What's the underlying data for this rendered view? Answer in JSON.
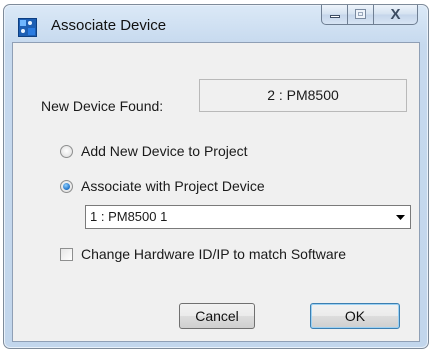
{
  "window": {
    "title": "Associate Device",
    "close_glyph": "X"
  },
  "device_found": {
    "label": "New Device Found:",
    "value": "2 : PM8500"
  },
  "options": {
    "add_new": {
      "label": "Add New Device to Project",
      "selected": false
    },
    "associate": {
      "label": "Associate with Project Device",
      "selected": true
    }
  },
  "project_device": {
    "selected": "1 : PM8500 1"
  },
  "change_hw": {
    "label": "Change Hardware ID/IP to match Software",
    "checked": false
  },
  "buttons": {
    "cancel": "Cancel",
    "ok": "OK"
  },
  "icons": {
    "app": "device-app-icon",
    "minimize": "minimize-icon",
    "maximize": "maximize-icon",
    "close": "close-icon",
    "dropdown": "dropdown-arrow-icon"
  },
  "colors": {
    "title_bar": "#c6d9ee",
    "client_bg": "#f0f0f0",
    "radio_selected": "#1d6fc4",
    "default_button_border": "#3c7fb1"
  }
}
